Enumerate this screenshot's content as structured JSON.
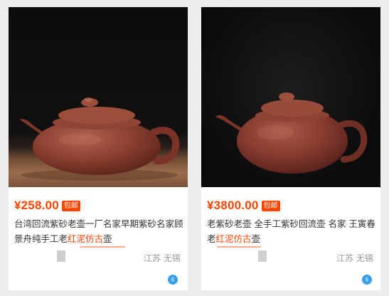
{
  "listings": [
    {
      "price": "¥258.00",
      "badge": "包邮",
      "title_prefix": "台湾回流紫砂老壶一厂名家早期紫砂名家顾景舟纯手工老",
      "title_highlight": "红泥仿古",
      "title_suffix": "壶",
      "location": "江苏 无锡",
      "image_icon": "teapot-photo"
    },
    {
      "price": "¥3800.00",
      "badge": "包邮",
      "title_prefix": "老紫砂老壶 全手工紫砂回流壶 名家 王寅春老",
      "title_highlight": "红泥仿古",
      "title_suffix": "壶",
      "location": "江苏 无锡",
      "image_icon": "teapot-photo"
    }
  ],
  "colors": {
    "accent": "#ff4400",
    "card_bg": "#ffffff",
    "page_bg": "#ededed"
  },
  "wangwang_icon": "chat-icon"
}
